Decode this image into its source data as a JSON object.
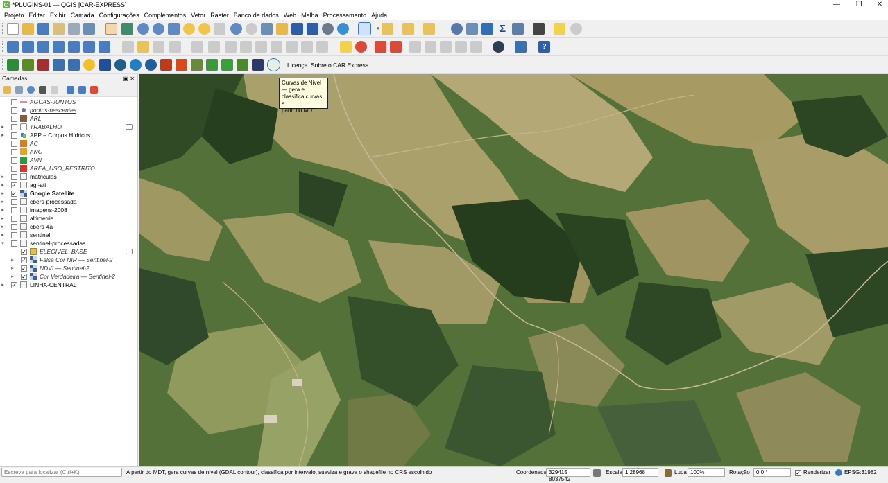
{
  "window": {
    "title": "*PLUGINS-01 — QGIS [CAR-EXPRESS]",
    "minimize": "—",
    "restore": "❐",
    "close": "✕"
  },
  "menu": [
    "Projeto",
    "Editar",
    "Exibir",
    "Camada",
    "Configurações",
    "Complementos",
    "Vetor",
    "Raster",
    "Banco de dados",
    "Web",
    "Malha",
    "Processamento",
    "Ajuda"
  ],
  "toolbar3": {
    "licenca": "Licença",
    "sobre": "Sobre o CAR Express"
  },
  "tooltip": "Curvas de Nível\n— gera e\nclassifica curvas a\npartir do MDT",
  "panel": {
    "title": "Camadas",
    "controls": "▣ ✕"
  },
  "layers": [
    {
      "label": "AGUAS-JUNTOS"
    },
    {
      "label": "pontos-nascentes"
    },
    {
      "label": "ARL"
    },
    {
      "label": "TRABALHO"
    },
    {
      "label": "APP – Corpos Hídricos"
    },
    {
      "label": "AC"
    },
    {
      "label": "ANC"
    },
    {
      "label": "AVN"
    },
    {
      "label": "AREA_USO_RESTRITO"
    },
    {
      "label": "matriculas"
    },
    {
      "label": "agi-ati"
    },
    {
      "label": "Google Satellite"
    },
    {
      "label": "cbers-processada"
    },
    {
      "label": "imagens-2008"
    },
    {
      "label": "altimetria"
    },
    {
      "label": "cbers-4a"
    },
    {
      "label": "sentinel"
    },
    {
      "label": "sentinel-processadas"
    },
    {
      "label": "ELEGIVEL_BASE"
    },
    {
      "label": "Falsa Cor NIR — Sentinel-2"
    },
    {
      "label": "NDVI — Sentinel-2"
    },
    {
      "label": "Cor Verdadeira — Sentinel-2"
    },
    {
      "label": "LINHA-CENTRAL"
    }
  ],
  "status": {
    "search_placeholder": "Escreva para localizar (Ctrl+K)",
    "message": "A partir do MDT, gera curvas de nível (GDAL contour), classifica por intervalo, suaviza e grava o shapefile no CRS escolhido",
    "coord_label": "Coordenada",
    "coord_value": "329415  8037542",
    "scale_label": "Escala",
    "scale_value": "1:28968",
    "lupa_label": "Lupa",
    "lupa_value": "100%",
    "rotation_label": "Rotação",
    "rotation_value": "0,0 °",
    "render_label": "Renderizar",
    "crs": "EPSG:31982"
  },
  "colors": {
    "accent": "#3a78c4",
    "arl": "#8b5a3c",
    "ac": "#e07b1a",
    "anc": "#f0a020",
    "avn": "#2e9a3a",
    "area_uso_restrito": "#e0302a",
    "elegivel": "#e3c24a"
  }
}
